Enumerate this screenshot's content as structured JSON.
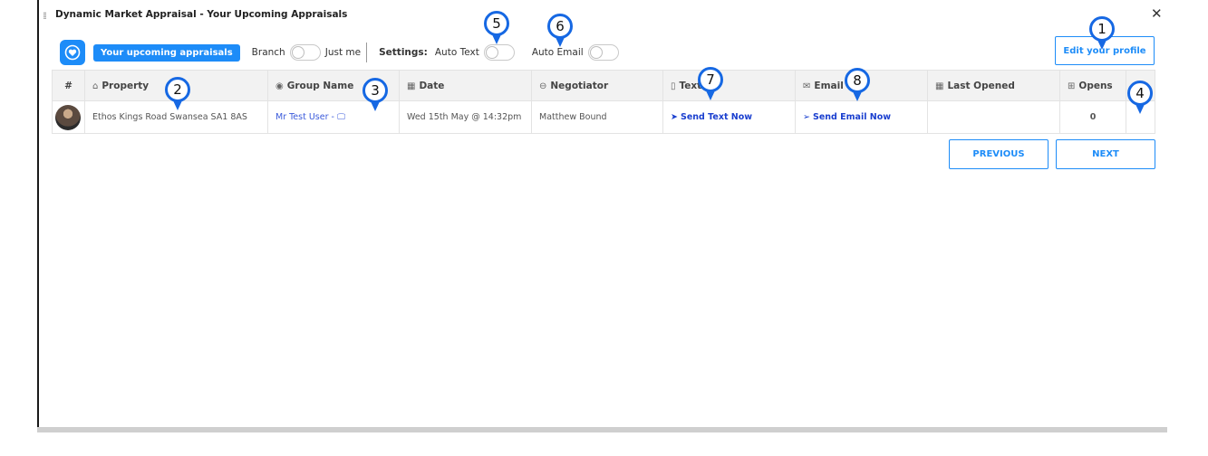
{
  "window": {
    "title": "Dynamic Market Appraisal - Your Upcoming Appraisals",
    "close_symbol": "✕"
  },
  "toolbar": {
    "tab_label": "Your upcoming appraisals",
    "branch_label": "Branch",
    "just_me_label": "Just me",
    "settings_label": "Settings:",
    "auto_text_label": "Auto Text",
    "auto_email_label": "Auto Email",
    "edit_profile_label": "Edit your profile"
  },
  "table": {
    "headers": {
      "num": "#",
      "property": "Property",
      "group": "Group Name",
      "date": "Date",
      "negotiator": "Negotiator",
      "text": "Text",
      "email": "Email",
      "last_opened": "Last Opened",
      "opens": "Opens"
    },
    "rows": [
      {
        "property": "Ethos Kings Road Swansea SA1 8AS",
        "group": "Mr Test User",
        "date": "Wed 15th May @ 14:32pm",
        "negotiator": "Matthew Bound",
        "text_action": "Send Text Now",
        "email_action": "Send Email Now",
        "last_opened": "",
        "opens": "0"
      }
    ]
  },
  "pagination": {
    "previous_label": "PREVIOUS",
    "next_label": "NEXT"
  },
  "markers": [
    "1",
    "2",
    "3",
    "4",
    "5",
    "6",
    "7",
    "8"
  ],
  "icons": [
    "drag-handle-icon",
    "close-icon",
    "heart-logo-icon",
    "home-icon",
    "user-circle-icon",
    "calendar-icon",
    "user-icon",
    "mobile-icon",
    "envelope-icon",
    "grid-icon",
    "monitor-icon",
    "send-icon",
    "location-pin-icon"
  ],
  "colors": {
    "accent": "#1d8cf8",
    "link": "#3b5bdb",
    "opens_zero": "#e02020",
    "marker_blue": "#1668e3"
  }
}
